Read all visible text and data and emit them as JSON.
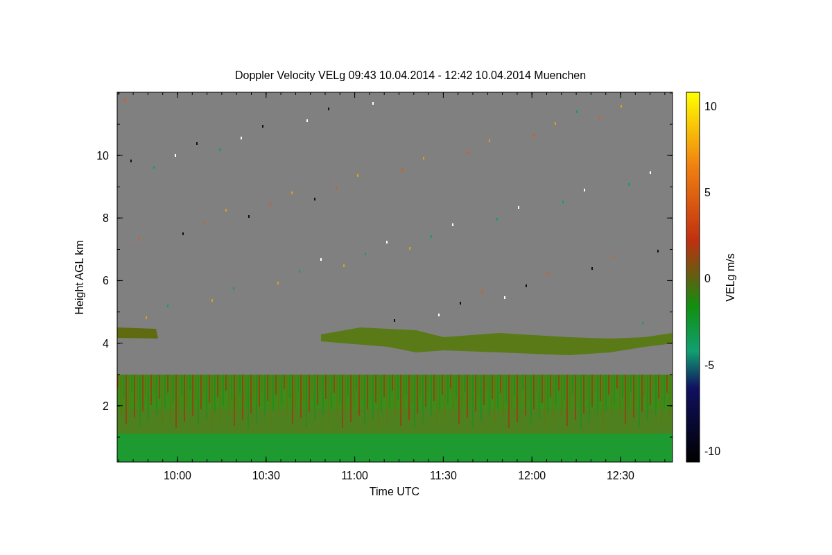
{
  "title": "Doppler Velocity VELg   09:43 10.04.2014 - 12:42 10.04.2014 Muenchen",
  "x_axis": {
    "label": "Time UTC",
    "ticks": [
      "10:00",
      "10:30",
      "11:00",
      "11:30",
      "12:00",
      "12:30"
    ]
  },
  "y_axis": {
    "label": "Height AGL km",
    "ticks": [
      "10",
      "8",
      "6",
      "4",
      "2"
    ]
  },
  "colorbar": {
    "label": "VELg m/s",
    "ticks": [
      "10",
      "5",
      "0",
      "-5",
      "-10"
    ]
  }
}
